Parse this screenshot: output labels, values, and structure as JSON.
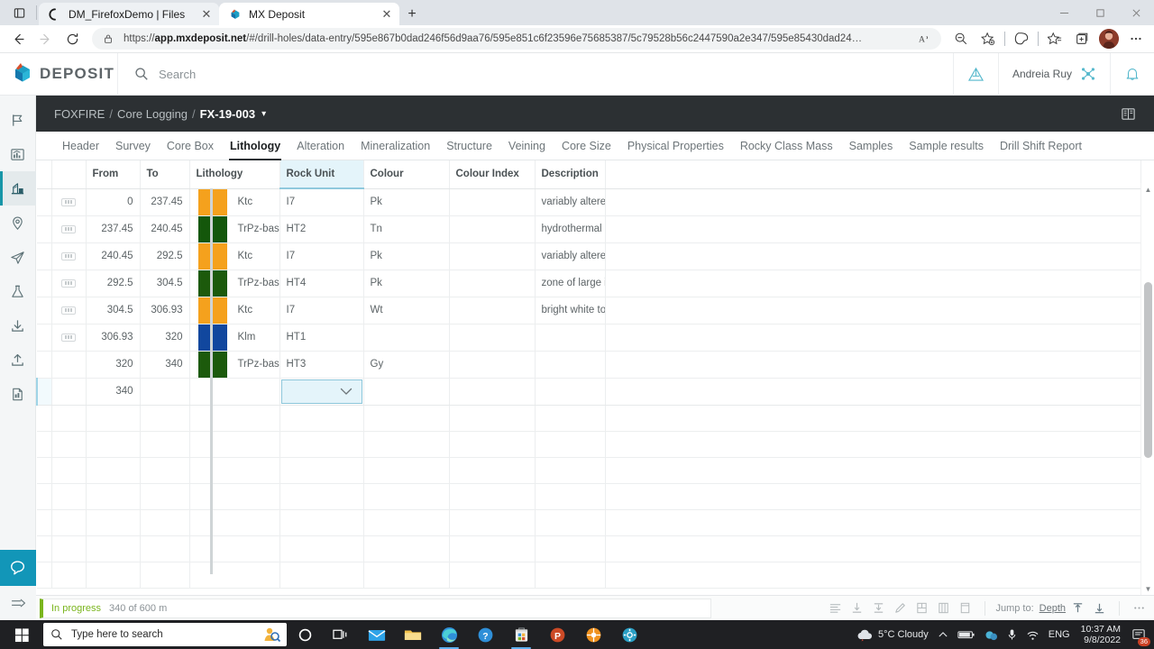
{
  "browser": {
    "tabs": [
      {
        "title": "DM_FirefoxDemo | Files",
        "favicon": "firefox-circle-icon",
        "active": false
      },
      {
        "title": "MX Deposit",
        "favicon": "mxdeposit-icon",
        "active": true
      }
    ],
    "new_tab_label": "+",
    "url_prefix": "https://",
    "url_domain": "app.mxdeposit.net",
    "url_path": "/#/drill-holes/data-entry/595e867b0dad246f56d9aa76/595e851c6f23596e75685387/5c79528b56c2447590a2e347/595e85430dad24…",
    "window_controls": {
      "minimize": "−",
      "maximize": "◻",
      "close": "✕"
    },
    "toolbar_icons": [
      "back-arrow-icon",
      "forward-arrow-icon",
      "reload-icon",
      "lock-icon",
      "read-aloud-icon",
      "zoom-out-icon",
      "add-favorite-icon",
      "split-screen-icon",
      "favorites-icon",
      "collections-icon",
      "profile-avatar",
      "settings-more-icon"
    ]
  },
  "app_header": {
    "brand": "DEPOSIT",
    "search_placeholder": "Search",
    "user_name": "Andreia Ruy",
    "icons": [
      "pyramid-icon",
      "share-nodes-icon",
      "bell-icon"
    ]
  },
  "sidebar": {
    "items": [
      {
        "name": "flag-icon",
        "active": false
      },
      {
        "name": "chart-icon",
        "active": false
      },
      {
        "name": "drill-rig-icon",
        "active": true
      },
      {
        "name": "map-pin-icon",
        "active": false
      },
      {
        "name": "paper-plane-icon",
        "active": false
      },
      {
        "name": "flask-icon",
        "active": false
      },
      {
        "name": "download-icon",
        "active": false
      },
      {
        "name": "upload-icon",
        "active": false
      },
      {
        "name": "document-icon",
        "active": false
      }
    ]
  },
  "breadcrumb": {
    "project": "FOXFIRE",
    "section": "Core Logging",
    "hole": "FX-19-003",
    "sep": "/",
    "caret": "▾"
  },
  "tabs": [
    {
      "label": "Header",
      "active": false
    },
    {
      "label": "Survey",
      "active": false
    },
    {
      "label": "Core Box",
      "active": false
    },
    {
      "label": "Lithology",
      "active": true
    },
    {
      "label": "Alteration",
      "active": false
    },
    {
      "label": "Mineralization",
      "active": false
    },
    {
      "label": "Structure",
      "active": false
    },
    {
      "label": "Veining",
      "active": false
    },
    {
      "label": "Core Size",
      "active": false
    },
    {
      "label": "Physical Properties",
      "active": false
    },
    {
      "label": "Rocky Class Mass",
      "active": false
    },
    {
      "label": "Samples",
      "active": false
    },
    {
      "label": "Sample results",
      "active": false
    },
    {
      "label": "Drill Shift Report",
      "active": false
    }
  ],
  "table": {
    "columns": [
      "From",
      "To",
      "Lithology",
      "Rock Unit",
      "Colour",
      "Colour Index",
      "Description"
    ],
    "selected_column": "Rock Unit",
    "rows": [
      {
        "from": "0",
        "to": "237.45",
        "swatch": "#F5A11D",
        "lithology": "Ktc",
        "rock_unit": "I7",
        "colour": "Pk",
        "colour_index": "",
        "description": "variably altere..."
      },
      {
        "from": "237.45",
        "to": "240.45",
        "swatch": "#14570B",
        "lithology": "TrPz-bas",
        "rock_unit": "HT2",
        "colour": "Tn",
        "colour_index": "",
        "description": "hydrothermal ..."
      },
      {
        "from": "240.45",
        "to": "292.5",
        "swatch": "#F5A11D",
        "lithology": "Ktc",
        "rock_unit": "I7",
        "colour": "Pk",
        "colour_index": "",
        "description": "variably altere..."
      },
      {
        "from": "292.5",
        "to": "304.5",
        "swatch": "#1C5A0C",
        "lithology": "TrPz-bas",
        "rock_unit": "HT4",
        "colour": "Pk",
        "colour_index": "",
        "description": "zone of large i..."
      },
      {
        "from": "304.5",
        "to": "306.93",
        "swatch": "#F5A11D",
        "lithology": "Ktc",
        "rock_unit": "I7",
        "colour": "Wt",
        "colour_index": "",
        "description": "bright white to..."
      },
      {
        "from": "306.93",
        "to": "320",
        "swatch": "#11479E",
        "lithology": "Klm",
        "rock_unit": "HT1",
        "colour": "",
        "colour_index": "",
        "description": ""
      },
      {
        "from": "320",
        "to": "340",
        "swatch": "#1C5A0C",
        "lithology": "TrPz-bas",
        "rock_unit": "HT3",
        "colour": "Gy",
        "colour_index": "",
        "description": ""
      }
    ],
    "entry_row": {
      "from": "340",
      "to": "",
      "lithology": "",
      "rock_unit_placeholder": "",
      "dropdown_caret": "⌄"
    },
    "empty_row_count": 7
  },
  "footer": {
    "status_label": "In progress",
    "status_value": "340 of 600 m",
    "jump_to_label": "Jump to:",
    "jump_to_value": "Depth",
    "tool_icons": [
      "align-icon",
      "insert-below-icon",
      "insert-bottom-icon",
      "edit-pencil-icon",
      "merge-rows-icon",
      "columns-icon",
      "table-icon",
      "jump-up-icon",
      "jump-down-icon",
      "more-icon"
    ]
  },
  "taskbar": {
    "search_placeholder": "Type here to search",
    "apps": [
      "cortana-icon",
      "task-view-icon",
      "mail-icon",
      "file-explorer-icon",
      "edge-icon",
      "help-icon",
      "store-icon",
      "powerpoint-icon",
      "orange-app-icon",
      "settings-icon"
    ],
    "weather": "5°C  Cloudy",
    "language": "ENG",
    "time": "10:37 AM",
    "date": "9/8/2022",
    "notification_count": "36",
    "tray_icons": [
      "chevron-up-icon",
      "battery-icon",
      "network-icon",
      "microphone-icon",
      "wifi-icon"
    ]
  }
}
